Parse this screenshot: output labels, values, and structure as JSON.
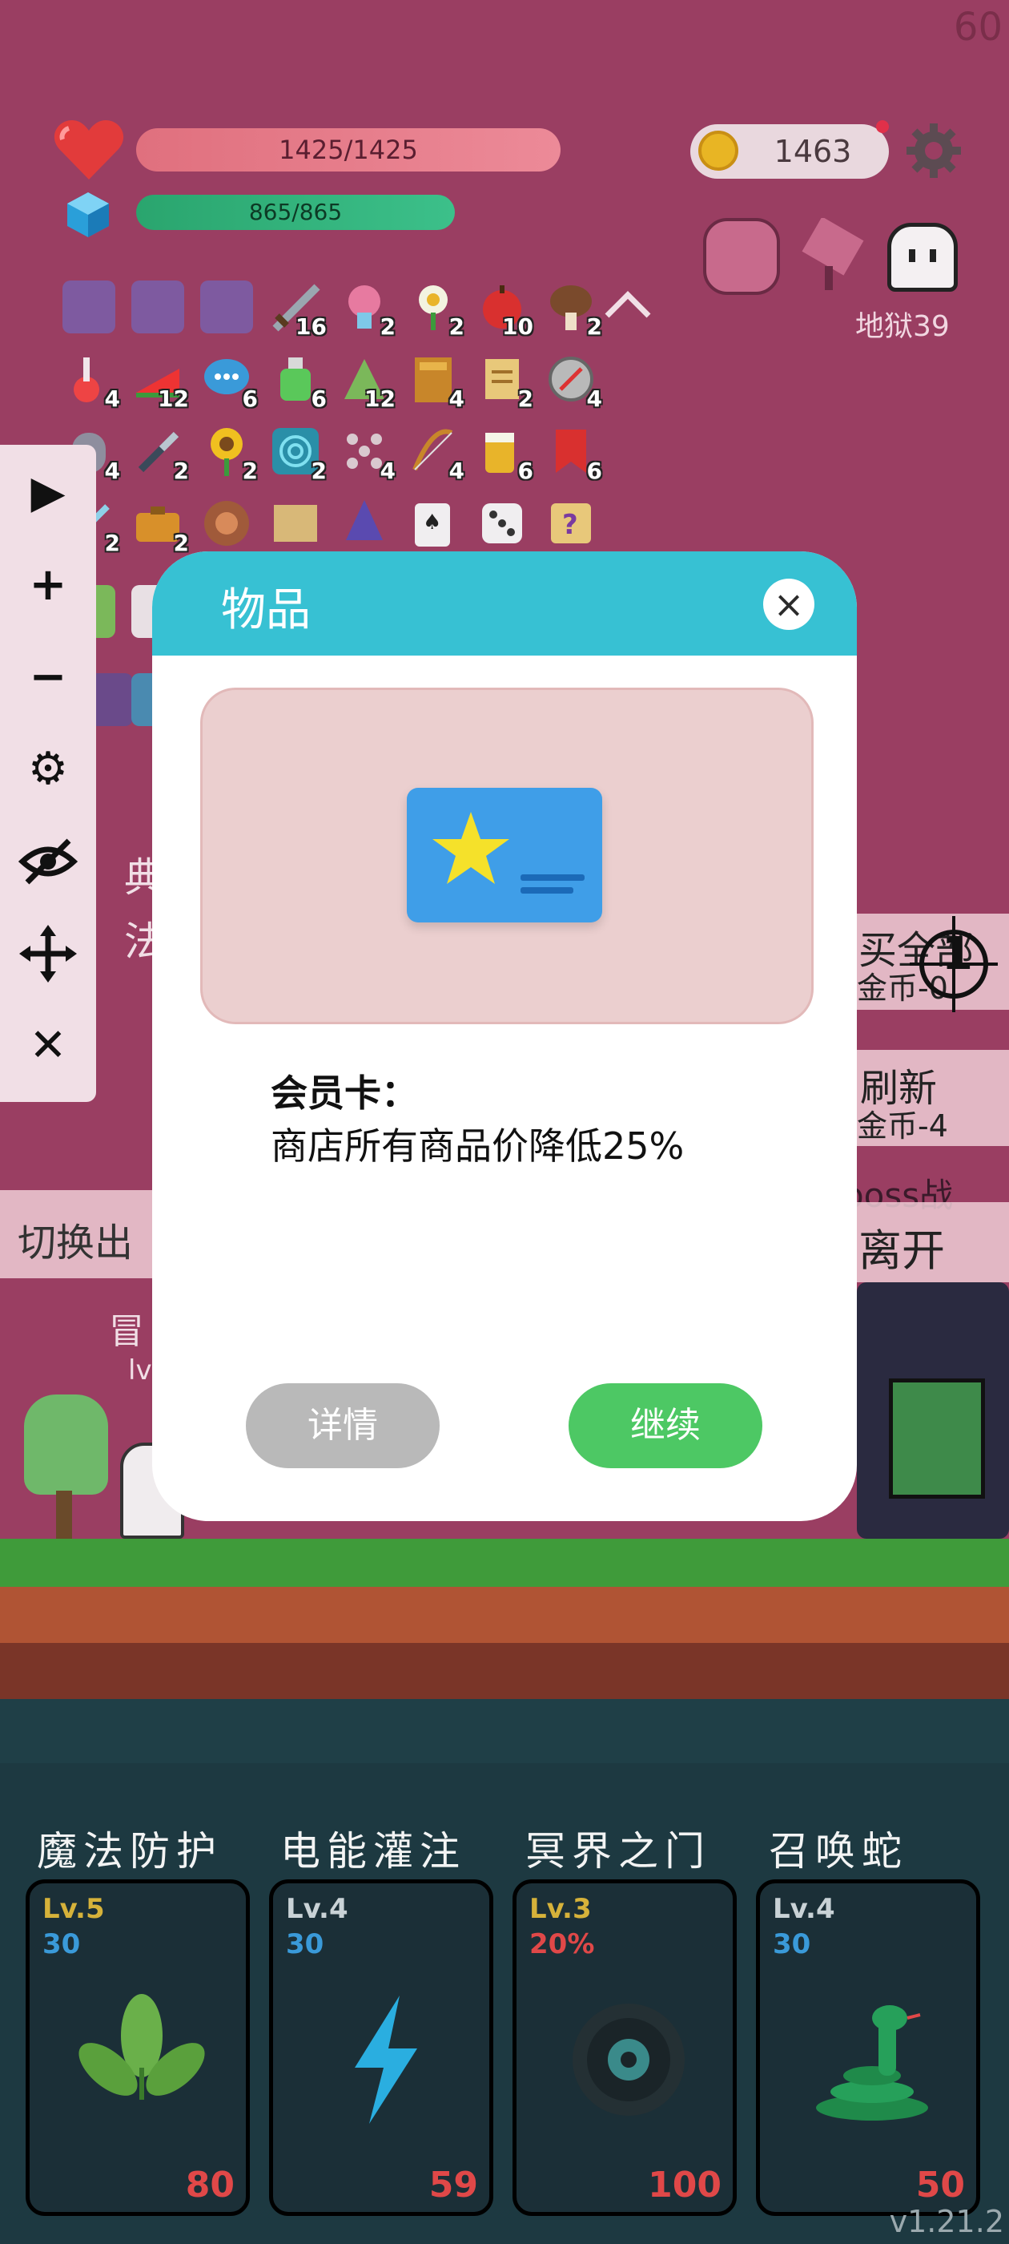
{
  "hud": {
    "fps": "60",
    "hp_text": "1425/1425",
    "mp_text": "865/865",
    "gold": "1463",
    "floor": "地狱39"
  },
  "inventory_counts": [
    "16",
    "2",
    "2",
    "10",
    "2",
    "4",
    "12",
    "6",
    "6",
    "12",
    "4",
    "2",
    "4",
    "4",
    "2",
    "2",
    "2",
    "4",
    "4",
    "6",
    "6",
    "2",
    "2"
  ],
  "side_buttons": {
    "buy_all": "买全部",
    "buy_all_cost": "金币-0",
    "refresh": "刷新",
    "refresh_cost": "金币-4",
    "boss": "boss战",
    "leave": "离开",
    "switch": "切换出",
    "target_count": "1"
  },
  "bg_text": {
    "left1": "典",
    "left2": "法",
    "adventurer": "冒",
    "lv": "lv"
  },
  "modal": {
    "title": "物品",
    "close": "×",
    "item_name": "会员卡：",
    "item_desc": "商店所有商品价降低25%",
    "detail_button": "详情",
    "continue_button": "继续"
  },
  "skills": [
    {
      "title": "魔法防护",
      "level": "Lv.5",
      "sub": "30",
      "cost": "80",
      "level_color": "#d6b23a",
      "sub_color": "#3a9ad9",
      "icon": "leaf-icon"
    },
    {
      "title": "电能灌注",
      "level": "Lv.4",
      "sub": "30",
      "cost": "59",
      "level_color": "#c9d2d6",
      "sub_color": "#3a9ad9",
      "icon": "lightning-icon"
    },
    {
      "title": "冥界之门",
      "level": "Lv.3",
      "sub": "20%",
      "cost": "100",
      "level_color": "#d6b23a",
      "sub_color": "#e04848",
      "icon": "portal-icon"
    },
    {
      "title": "召唤蛇",
      "level": "Lv.4",
      "sub": "30",
      "cost": "50",
      "level_color": "#c9d2d6",
      "sub_color": "#3a9ad9",
      "icon": "snake-icon"
    }
  ],
  "version": "v1.21.2"
}
